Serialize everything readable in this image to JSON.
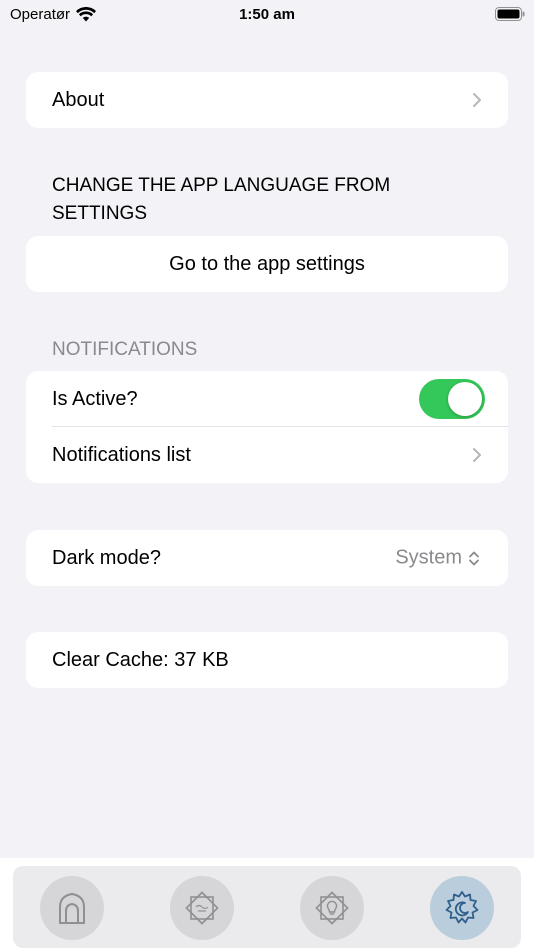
{
  "status_bar": {
    "carrier": "Operatør",
    "time": "1:50 am"
  },
  "about": {
    "label": "About"
  },
  "language": {
    "header": "CHANGE THE APP LANGUAGE FROM SETTINGS",
    "button_label": "Go to the app settings"
  },
  "notifications": {
    "header": "NOTIFICATIONS",
    "is_active_label": "Is Active?",
    "is_active": true,
    "list_label": "Notifications list"
  },
  "dark_mode": {
    "label": "Dark mode?",
    "value": "System"
  },
  "cache": {
    "label": "Clear Cache: 37 KB"
  },
  "tabs": [
    {
      "name": "home-icon",
      "active": false
    },
    {
      "name": "dhikr-icon",
      "active": false
    },
    {
      "name": "lightbulb-icon",
      "active": false
    },
    {
      "name": "settings-icon",
      "active": true
    }
  ],
  "colors": {
    "background": "#f2f2f7",
    "toggle_on": "#34c759",
    "secondary_text": "#8a8a8e",
    "active_tab": "#b9cddc",
    "icon_active": "#2f5f8a"
  }
}
